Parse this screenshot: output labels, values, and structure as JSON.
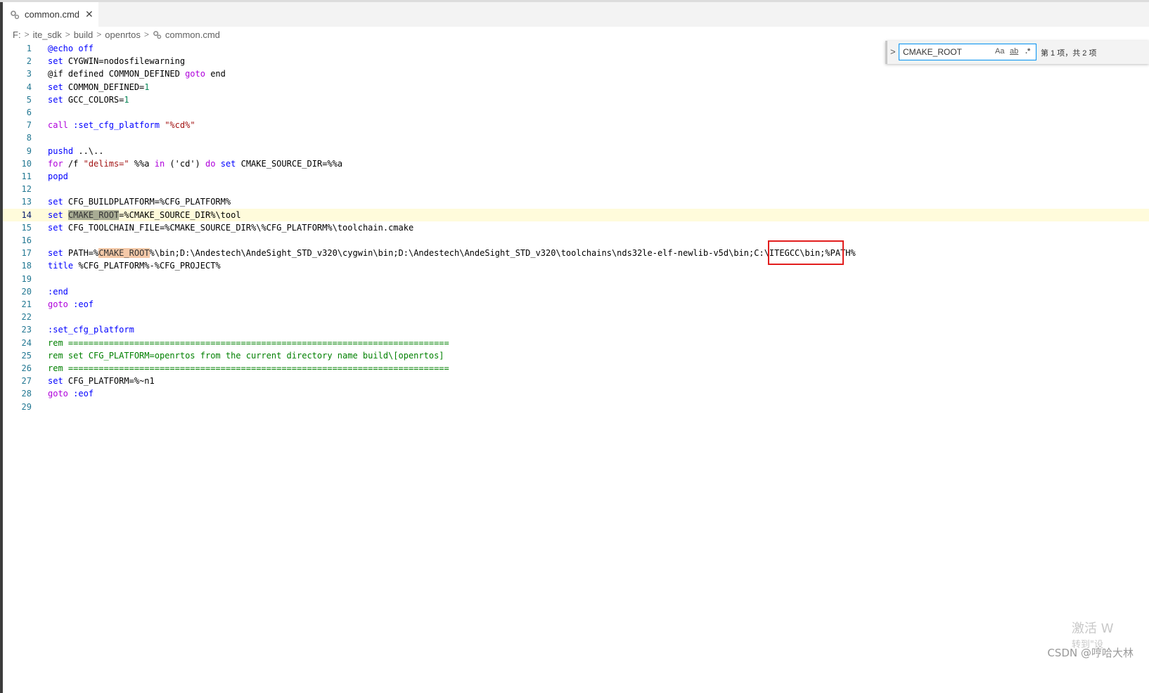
{
  "tab": {
    "filename": "common.cmd",
    "close_glyph": "✕",
    "icon": "gear-icon"
  },
  "breadcrumb": {
    "segments": [
      "F:",
      "ite_sdk",
      "build",
      "openrtos"
    ],
    "file": "common.cmd",
    "separator": ">"
  },
  "find": {
    "toggle_glyph": ">",
    "value": "CMAKE_ROOT",
    "options": {
      "match_case": "Aa",
      "whole_word": "ab",
      "regex": ".*"
    },
    "result_text": "第 1 项，共 2 项"
  },
  "editor": {
    "current_line": 14,
    "lines": [
      {
        "n": "1",
        "tokens": [
          [
            "cmd",
            "@echo"
          ],
          [
            "plain",
            " "
          ],
          [
            "cmd",
            "off"
          ]
        ]
      },
      {
        "n": "2",
        "tokens": [
          [
            "cmd",
            "set"
          ],
          [
            "plain",
            " CYGWIN=nodosfilewarning"
          ]
        ]
      },
      {
        "n": "3",
        "tokens": [
          [
            "plain",
            "@if defined COMMON_DEFINED "
          ],
          [
            "kw",
            "goto"
          ],
          [
            "plain",
            " end"
          ]
        ]
      },
      {
        "n": "4",
        "tokens": [
          [
            "cmd",
            "set"
          ],
          [
            "plain",
            " COMMON_DEFINED="
          ],
          [
            "num",
            "1"
          ]
        ]
      },
      {
        "n": "5",
        "tokens": [
          [
            "cmd",
            "set"
          ],
          [
            "plain",
            " GCC_COLORS="
          ],
          [
            "num",
            "1"
          ]
        ]
      },
      {
        "n": "6",
        "tokens": []
      },
      {
        "n": "7",
        "tokens": [
          [
            "kw",
            "call"
          ],
          [
            "plain",
            " "
          ],
          [
            "label",
            ":set_cfg_platform"
          ],
          [
            "plain",
            " "
          ],
          [
            "str",
            "\"%cd%\""
          ]
        ]
      },
      {
        "n": "8",
        "tokens": []
      },
      {
        "n": "9",
        "tokens": [
          [
            "cmd",
            "pushd"
          ],
          [
            "plain",
            " ..\\.."
          ]
        ]
      },
      {
        "n": "10",
        "tokens": [
          [
            "kw",
            "for"
          ],
          [
            "plain",
            " /f "
          ],
          [
            "str",
            "\"delims=\""
          ],
          [
            "plain",
            " %%a "
          ],
          [
            "kw",
            "in"
          ],
          [
            "plain",
            " ('cd') "
          ],
          [
            "kw",
            "do"
          ],
          [
            "plain",
            " "
          ],
          [
            "cmd",
            "set"
          ],
          [
            "plain",
            " CMAKE_SOURCE_DIR=%%a"
          ]
        ]
      },
      {
        "n": "11",
        "tokens": [
          [
            "cmd",
            "popd"
          ]
        ]
      },
      {
        "n": "12",
        "tokens": []
      },
      {
        "n": "13",
        "tokens": [
          [
            "cmd",
            "set"
          ],
          [
            "plain",
            " CFG_BUILDPLATFORM=%CFG_PLATFORM%"
          ]
        ]
      },
      {
        "n": "14",
        "tokens": [
          [
            "cmd",
            "set"
          ],
          [
            "plain",
            " "
          ],
          [
            "match-active",
            "CMAKE_ROOT"
          ],
          [
            "plain",
            "=%CMAKE_SOURCE_DIR%\\tool"
          ]
        ]
      },
      {
        "n": "15",
        "tokens": [
          [
            "cmd",
            "set"
          ],
          [
            "plain",
            " CFG_TOOLCHAIN_FILE=%CMAKE_SOURCE_DIR%\\%CFG_PLATFORM%\\toolchain.cmake"
          ]
        ]
      },
      {
        "n": "16",
        "tokens": []
      },
      {
        "n": "17",
        "tokens": [
          [
            "cmd",
            "set"
          ],
          [
            "plain",
            " PATH=%"
          ],
          [
            "match",
            "CMAKE_ROOT"
          ],
          [
            "plain",
            "%\\bin;D:\\Andestech\\AndeSight_STD_v320\\cygwin\\bin;D:\\Andestech\\AndeSight_STD_v320\\toolchains\\nds32le-elf-newlib-v5d\\bin;C:\\ITEGCC\\bin;%PATH%"
          ]
        ]
      },
      {
        "n": "18",
        "tokens": [
          [
            "cmd",
            "title"
          ],
          [
            "plain",
            " %CFG_PLATFORM%-%CFG_PROJECT%"
          ]
        ]
      },
      {
        "n": "19",
        "tokens": []
      },
      {
        "n": "20",
        "tokens": [
          [
            "label",
            ":end"
          ]
        ]
      },
      {
        "n": "21",
        "tokens": [
          [
            "kw",
            "goto"
          ],
          [
            "plain",
            " "
          ],
          [
            "label",
            ":eof"
          ]
        ]
      },
      {
        "n": "22",
        "tokens": []
      },
      {
        "n": "23",
        "tokens": [
          [
            "label",
            ":set_cfg_platform"
          ]
        ]
      },
      {
        "n": "24",
        "tokens": [
          [
            "comment",
            "rem ==========================================================================="
          ]
        ]
      },
      {
        "n": "25",
        "tokens": [
          [
            "comment",
            "rem set CFG_PLATFORM=openrtos from the current directory name build\\[openrtos]"
          ]
        ]
      },
      {
        "n": "26",
        "tokens": [
          [
            "comment",
            "rem ==========================================================================="
          ]
        ]
      },
      {
        "n": "27",
        "tokens": [
          [
            "cmd",
            "set"
          ],
          [
            "plain",
            " CFG_PLATFORM=%~n1"
          ]
        ]
      },
      {
        "n": "28",
        "tokens": [
          [
            "kw",
            "goto"
          ],
          [
            "plain",
            " "
          ],
          [
            "label",
            ":eof"
          ]
        ]
      },
      {
        "n": "29",
        "tokens": []
      }
    ]
  },
  "watermark": {
    "line1": "激活 W",
    "line2": "转到\"设"
  },
  "credit": "CSDN @哼哈大林",
  "colors": {
    "current_line_bg": "#fffbdb",
    "find_border": "#0090f1",
    "annotation_box": "#e21d1d",
    "line_number": "#237893"
  }
}
